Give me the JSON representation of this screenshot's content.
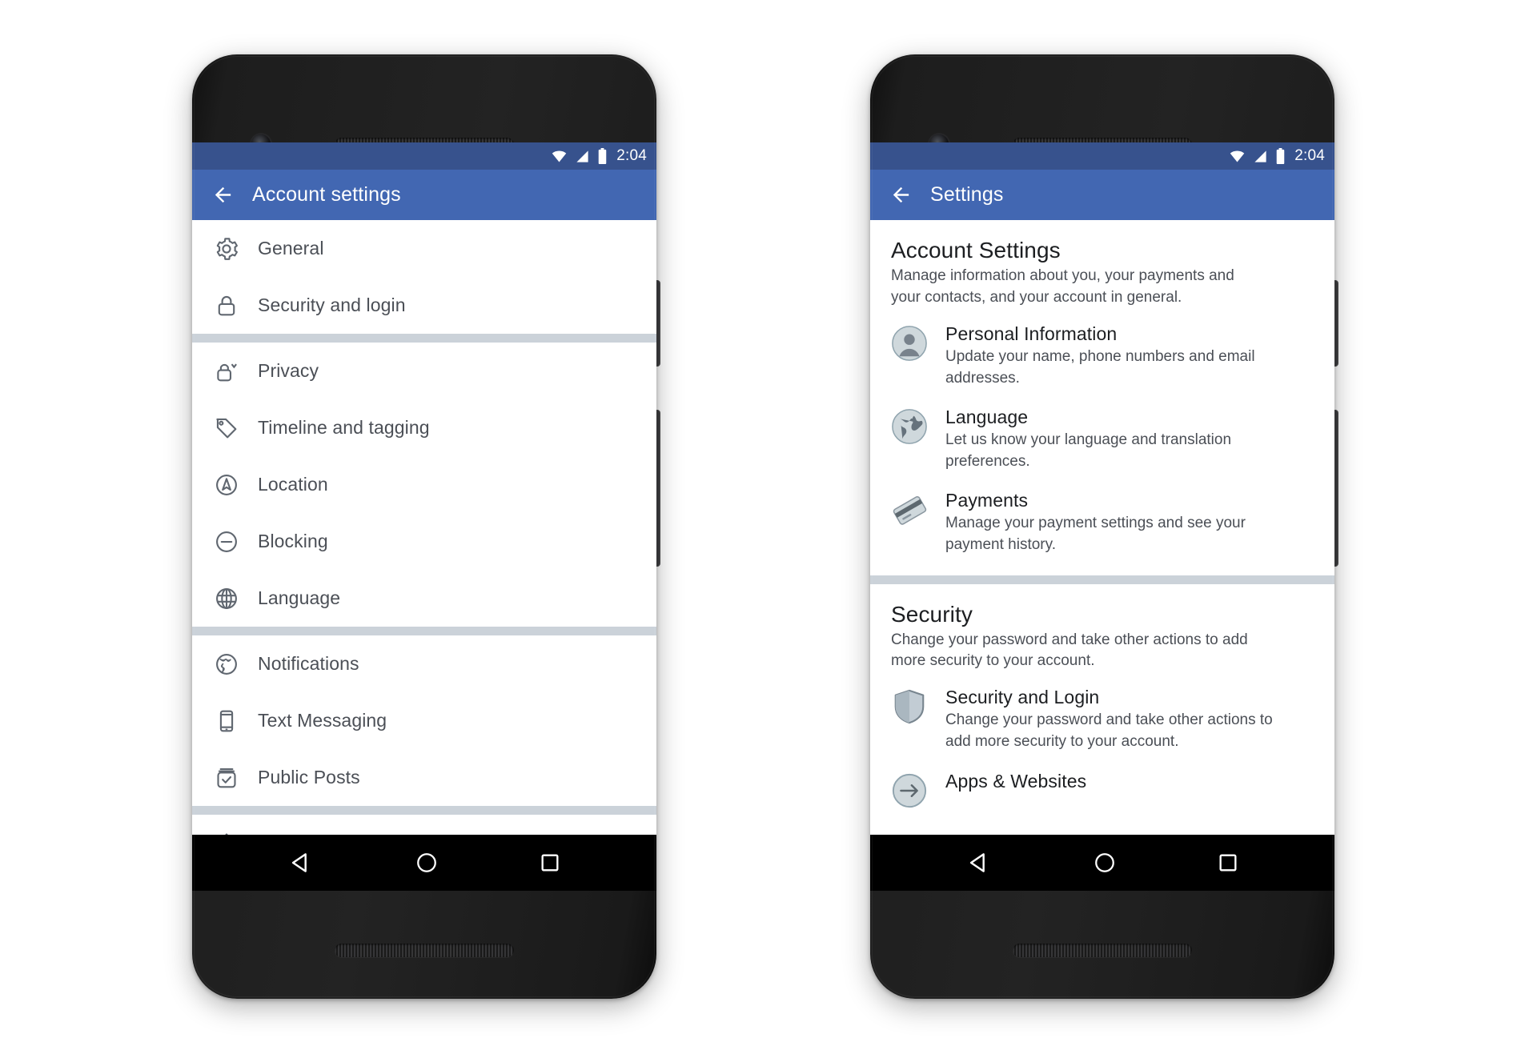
{
  "statusbar": {
    "time": "2:04",
    "icons": [
      "wifi-icon",
      "cell-signal-icon",
      "battery-icon"
    ]
  },
  "colors": {
    "appbar": "#4267b2",
    "statusbar": "#37528d",
    "divider": "#cbd2d9",
    "primary_text": "#1c1e21",
    "secondary_text": "#4b4f56",
    "icon_outline": "#606770"
  },
  "phone_left": {
    "appbar": {
      "title": "Account settings",
      "back_icon": "back-arrow-icon"
    },
    "groups": [
      {
        "items": [
          {
            "label": "General",
            "icon": "gear-icon"
          },
          {
            "label": "Security and login",
            "icon": "lock-icon"
          }
        ]
      },
      {
        "items": [
          {
            "label": "Privacy",
            "icon": "privacy-lock-icon"
          },
          {
            "label": "Timeline and tagging",
            "icon": "tag-icon"
          },
          {
            "label": "Location",
            "icon": "compass-icon"
          },
          {
            "label": "Blocking",
            "icon": "block-icon"
          },
          {
            "label": "Language",
            "icon": "globe-grid-icon"
          }
        ]
      },
      {
        "items": [
          {
            "label": "Notifications",
            "icon": "globe-earth-icon"
          },
          {
            "label": "Text Messaging",
            "icon": "mobile-phone-icon"
          },
          {
            "label": "Public Posts",
            "icon": "checkbox-box-icon"
          }
        ]
      }
    ]
  },
  "phone_right": {
    "appbar": {
      "title": "Settings",
      "back_icon": "back-arrow-icon"
    },
    "sections": [
      {
        "title": "Account Settings",
        "subtitle": "Manage information about you, your payments and your contacts, and your account in general.",
        "items": [
          {
            "title": "Personal Information",
            "subtitle": "Update your name, phone numbers and email addresses.",
            "icon": "person-avatar-icon"
          },
          {
            "title": "Language",
            "subtitle": "Let us know your language and translation preferences.",
            "icon": "globe-earth-icon"
          },
          {
            "title": "Payments",
            "subtitle": "Manage your payment settings and see your payment history.",
            "icon": "credit-card-icon"
          }
        ]
      },
      {
        "title": "Security",
        "subtitle": "Change your password and take other actions to add more security to your account.",
        "items": [
          {
            "title": "Security and Login",
            "subtitle": "Change your password and take other actions to add more security to your account.",
            "icon": "shield-icon"
          },
          {
            "title": "Apps & Websites",
            "subtitle": "",
            "icon": "arrow-circle-icon"
          }
        ]
      }
    ]
  },
  "navbar": {
    "back_label": "back-nav-button",
    "home_label": "home-nav-button",
    "recents_label": "recents-nav-button"
  }
}
